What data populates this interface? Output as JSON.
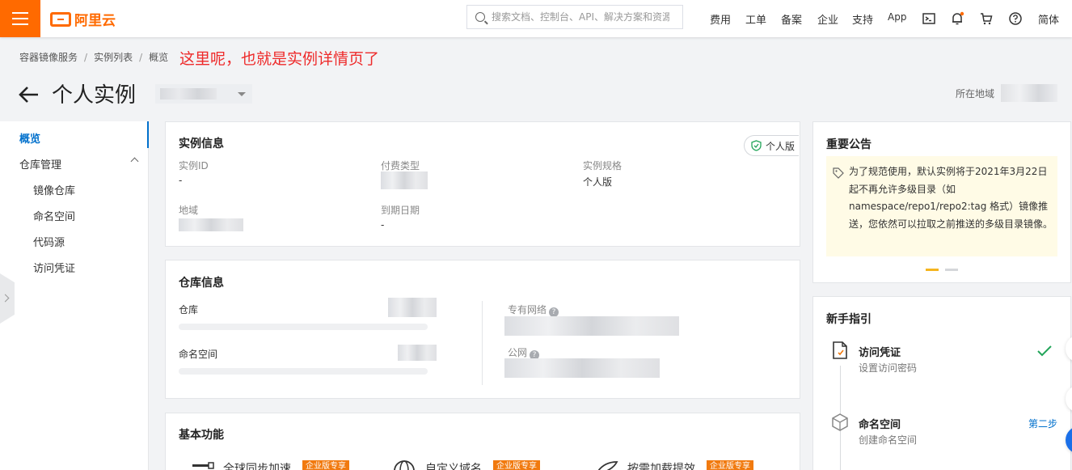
{
  "topbar": {
    "logo_text": "阿里云",
    "search_placeholder": "搜索文档、控制台、API、解决方案和资源",
    "nav": [
      "费用",
      "工单",
      "备案",
      "企业",
      "支持",
      "App"
    ],
    "lang": "简体",
    "brand_color": "#ff6a00",
    "icons": [
      "terminal-icon",
      "bell-icon",
      "cart-icon",
      "help-icon"
    ]
  },
  "breadcrumb": {
    "items": [
      "容器镜像服务",
      "实例列表",
      "概览"
    ],
    "separator": "/"
  },
  "annotation": "这里呢，也就是实例详情页了",
  "page": {
    "title": "个人实例",
    "region_label": "所在地域"
  },
  "sidebar": {
    "items": [
      {
        "label": "概览",
        "active": true
      },
      {
        "label": "仓库管理"
      },
      {
        "label": "镜像仓库"
      },
      {
        "label": "命名空间"
      },
      {
        "label": "代码源"
      },
      {
        "label": "访问凭证"
      }
    ]
  },
  "instance_info": {
    "title": "实例信息",
    "badge": "个人版",
    "fields": {
      "id_label": "实例ID",
      "id_value": "-",
      "pay_label": "付费类型",
      "spec_label": "实例规格",
      "spec_value": "个人版",
      "region_label": "地域",
      "expire_label": "到期日期",
      "expire_value": "-"
    }
  },
  "repo_info": {
    "title": "仓库信息",
    "repo_label": "仓库",
    "ns_label": "命名空间",
    "vpc_label": "专有网络",
    "public_label": "公网"
  },
  "features": {
    "title": "基本功能",
    "items": [
      {
        "label": "全球同步加速",
        "tag": "企业版专享"
      },
      {
        "label": "自定义域名",
        "tag": "企业版专享"
      },
      {
        "label": "按需加载提效",
        "tag": "企业版专享"
      }
    ]
  },
  "notice": {
    "title": "重要公告",
    "text": "为了规范使用，默认实例将于2021年3月22日起不再允许多级目录（如namespace/repo1/repo2:tag 格式）镜像推送，您依然可以拉取之前推送的多级目录镜像。"
  },
  "guide": {
    "title": "新手指引",
    "steps": [
      {
        "title": "访问凭证",
        "sub": "设置访问密码",
        "done": true
      },
      {
        "title": "命名空间",
        "sub": "创建命名空间",
        "action": "第二步"
      }
    ]
  }
}
